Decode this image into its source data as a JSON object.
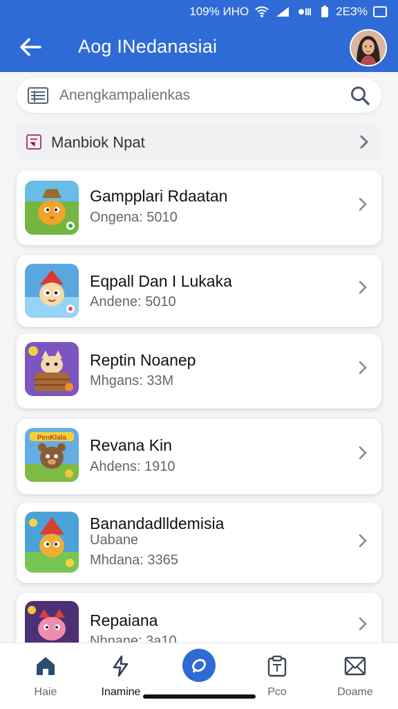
{
  "status": {
    "left_text": "109% ИНО",
    "right_text": "2ЕЗ%"
  },
  "header": {
    "title": "Aog INedanasiai"
  },
  "search": {
    "placeholder": "Anengkampalienkas"
  },
  "category": {
    "label": "Manbiok Npat"
  },
  "apps": [
    {
      "title": "Gampplari Rdaatan",
      "subtitle": "Ongena: 5010",
      "thumb": "orange-bird-character",
      "colors": [
        "#74b63f",
        "#f2a32c"
      ]
    },
    {
      "title": "Eqpall Dan I Lukaka",
      "subtitle": "Andene: 5010",
      "thumb": "gnome-character",
      "colors": [
        "#5aa6df",
        "#f6d9a6"
      ]
    },
    {
      "title": "Reptin Noanep",
      "subtitle": "Mhgans: 33M",
      "thumb": "cat-crate-character",
      "colors": [
        "#7c55c3",
        "#d38b45"
      ]
    },
    {
      "title": "Revana Kin",
      "subtitle": "Ahdens: 1910",
      "thumb": "brown-bear-character",
      "colors": [
        "#65aee3",
        "#8b5b36"
      ]
    },
    {
      "title": "Banandadlldemisia",
      "subtitle": "Uabane",
      "subtitle2": "Mhdana: 3365",
      "thumb": "gnome-character",
      "colors": [
        "#4aa3d8",
        "#f0ad36"
      ]
    },
    {
      "title": "Repaiana",
      "subtitle": "Nhnane: 3a10",
      "thumb": "red-cat-character",
      "colors": [
        "#4d2f75",
        "#f08cae"
      ]
    }
  ],
  "bottom_nav": [
    {
      "label": "Haie",
      "icon": "home-icon"
    },
    {
      "label": "Inamine",
      "icon": "lightning-icon"
    },
    {
      "label": "",
      "icon": "compass-icon"
    },
    {
      "label": "Pco",
      "icon": "clipboard-icon"
    },
    {
      "label": "Doame",
      "icon": "mail-icon"
    }
  ],
  "colors": {
    "primary": "#2f6bd6",
    "background": "#f4f5f7",
    "card": "#ffffff"
  }
}
